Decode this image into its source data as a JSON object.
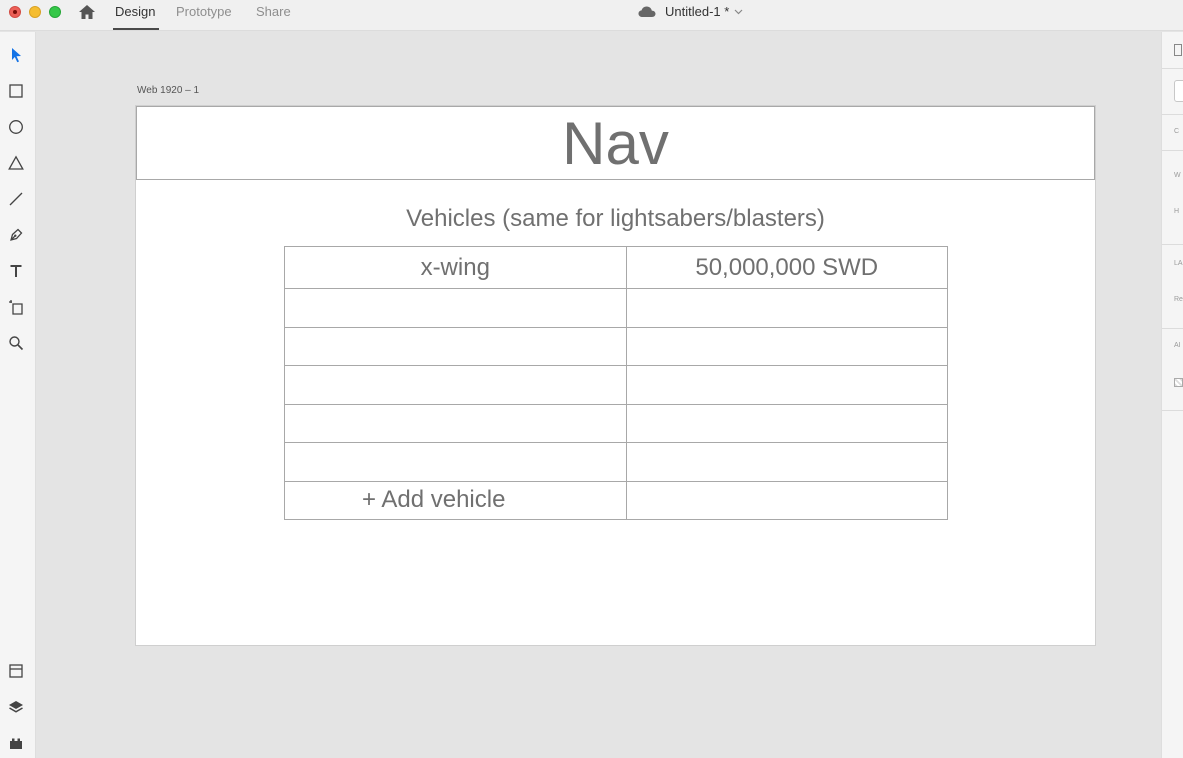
{
  "titlebar": {
    "tabs": [
      {
        "label": "Design",
        "active": true
      },
      {
        "label": "Prototype",
        "active": false
      },
      {
        "label": "Share",
        "active": false
      }
    ],
    "document_title": "Untitled-1 *"
  },
  "toolbar": {
    "tools": [
      "select-tool-icon",
      "rectangle-tool-icon",
      "ellipse-tool-icon",
      "polygon-tool-icon",
      "line-tool-icon",
      "pen-tool-icon",
      "text-tool-icon",
      "artboard-tool-icon",
      "zoom-tool-icon"
    ],
    "bottom": [
      "assets-icon",
      "layers-icon",
      "plugins-icon"
    ],
    "accent_color": "#1473e6"
  },
  "right_panel": {
    "labels": [
      "C",
      "W",
      "H",
      "LA",
      "Re",
      "AI"
    ]
  },
  "artboard": {
    "name": "Web 1920 – 1",
    "nav_text": "Nav",
    "heading": "Vehicles (same for lightsabers/blasters)",
    "table": {
      "rows": [
        [
          "x-wing",
          "50,000,000 SWD"
        ],
        [
          "",
          ""
        ],
        [
          "",
          ""
        ],
        [
          "",
          ""
        ],
        [
          "",
          ""
        ],
        [
          "",
          ""
        ]
      ],
      "add_label": "+ Add vehicle"
    }
  }
}
